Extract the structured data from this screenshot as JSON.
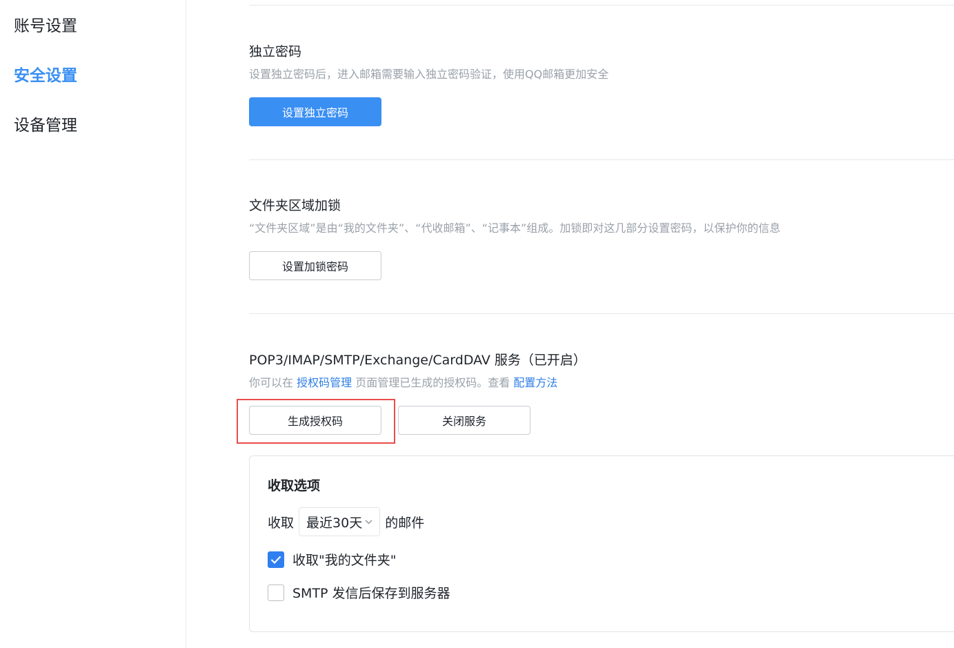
{
  "sidebar": {
    "items": [
      {
        "label": "账号设置",
        "active": false
      },
      {
        "label": "安全设置",
        "active": true
      },
      {
        "label": "设备管理",
        "active": false
      }
    ]
  },
  "independent_password": {
    "title": "独立密码",
    "description": "设置独立密码后，进入邮箱需要输入独立密码验证，使用QQ邮箱更加安全",
    "button_label": "设置独立密码"
  },
  "folder_lock": {
    "title": "文件夹区域加锁",
    "description": "“文件夹区域”是由“我的文件夹”、“代收邮箱”、“记事本”组成。加锁即对这几部分设置密码，以保护你的信息",
    "button_label": "设置加锁密码"
  },
  "pop3_service": {
    "title": "POP3/IMAP/SMTP/Exchange/CardDAV 服务（已开启）",
    "desc_prefix": "你可以在",
    "desc_link1": "授权码管理",
    "desc_middle": "页面管理已生成的授权码。查看",
    "desc_link2": "配置方法",
    "generate_button": "生成授权码",
    "close_button": "关闭服务"
  },
  "receive_options": {
    "title": "收取选项",
    "receive_prefix": "收取",
    "receive_range": "最近30天",
    "receive_suffix": "的邮件",
    "option1_label": "收取\"我的文件夹\"",
    "option1_checked": true,
    "option2_label": "SMTP 发信后保存到服务器",
    "option2_checked": false
  },
  "colors": {
    "accent": "#3a8ff3",
    "link": "#2d7ee6",
    "highlight_box": "#e94c4c"
  }
}
